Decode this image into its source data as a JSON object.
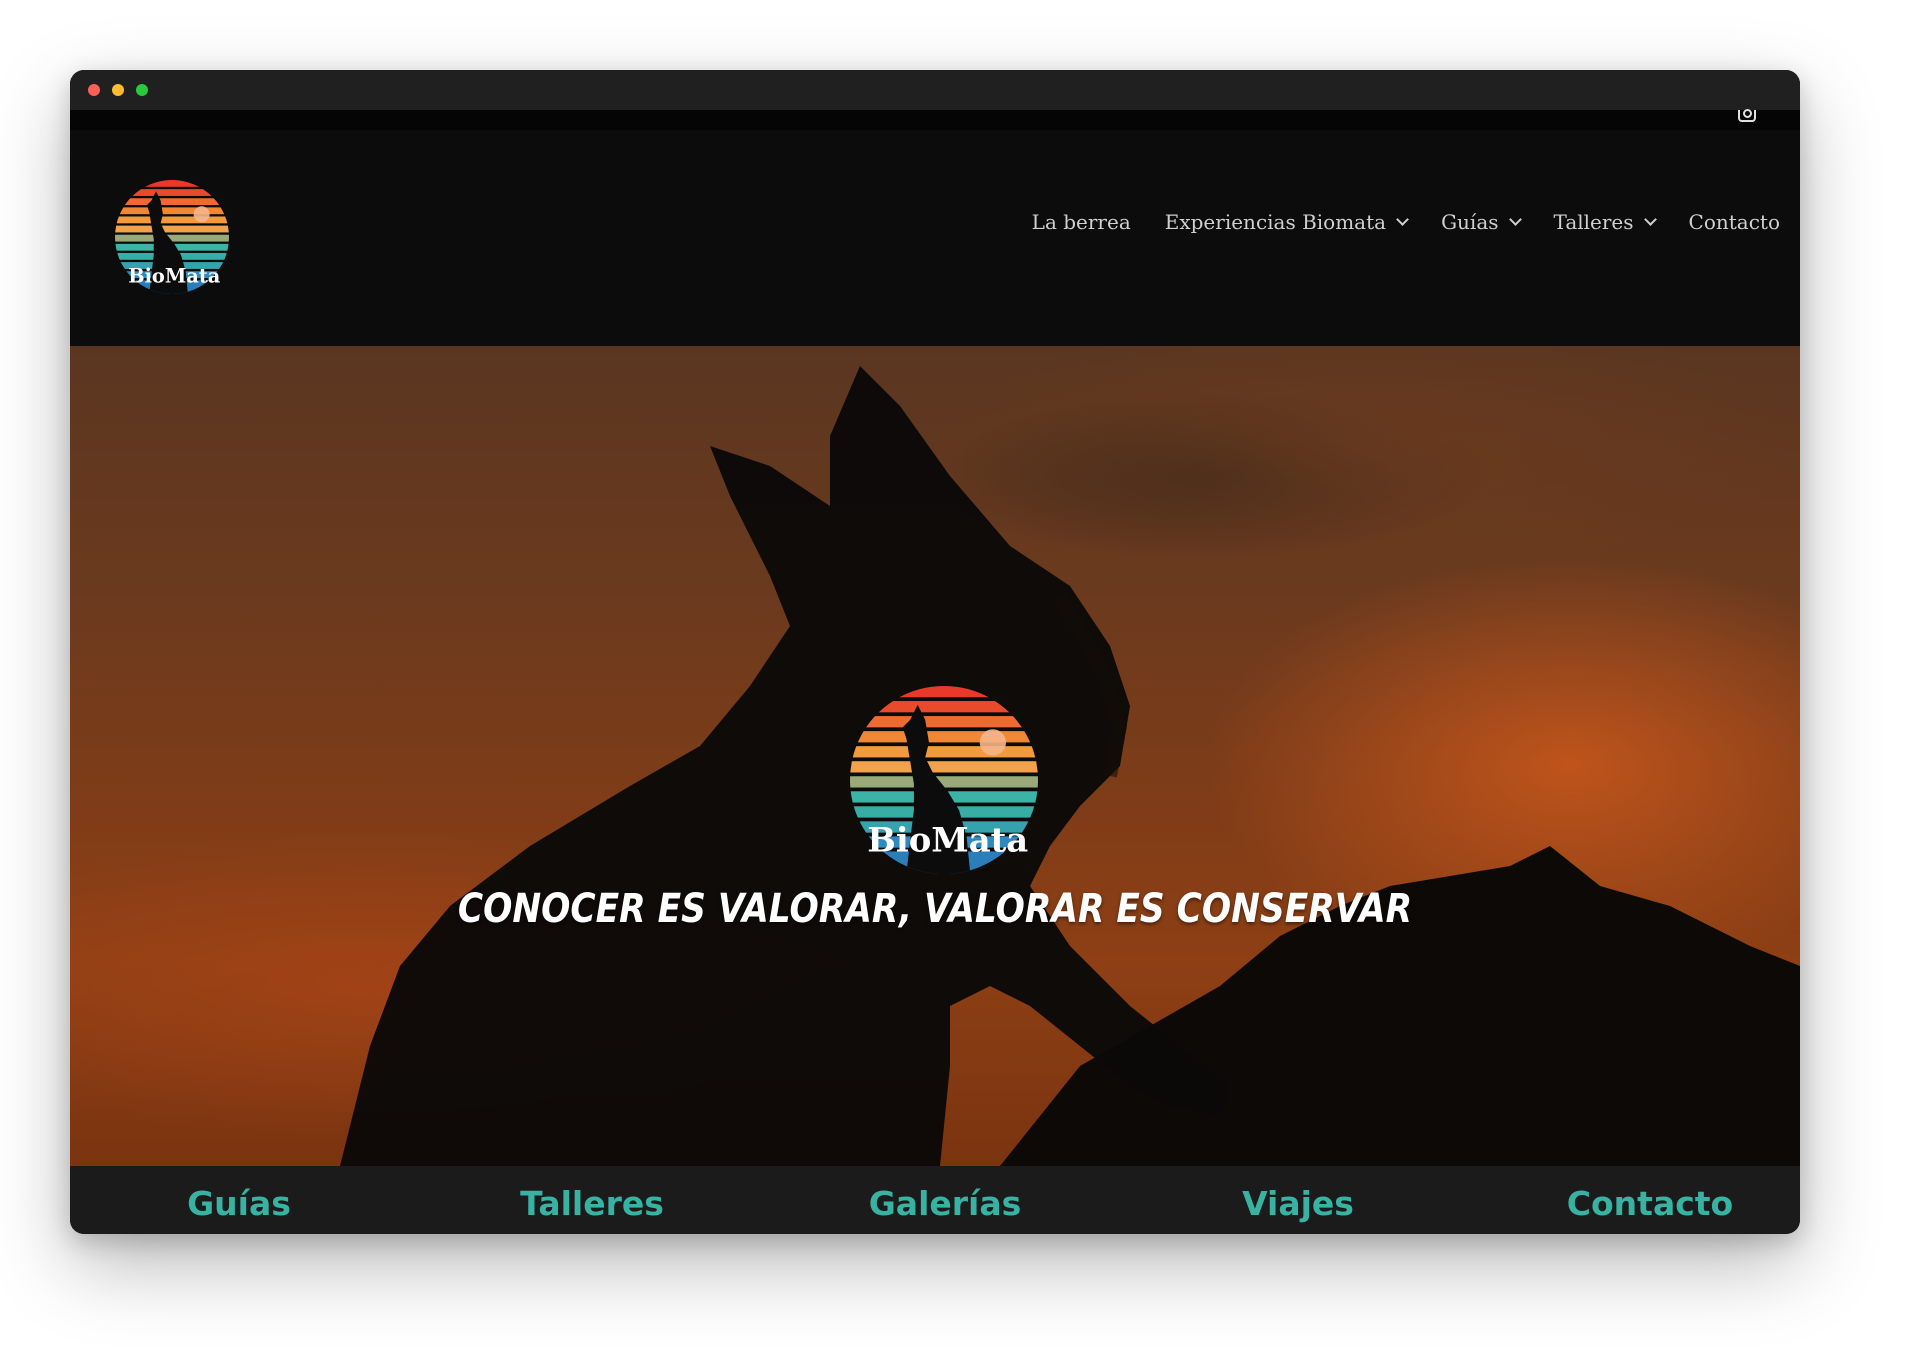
{
  "window": {
    "controls": [
      "close",
      "minimize",
      "maximize"
    ]
  },
  "topbar": {
    "social_icon": "instagram-icon"
  },
  "header": {
    "logo_text": "BioMata",
    "nav": [
      {
        "label": "La berrea",
        "has_dropdown": false
      },
      {
        "label": "Experiencias Biomata",
        "has_dropdown": true
      },
      {
        "label": "Guías",
        "has_dropdown": true
      },
      {
        "label": "Talleres",
        "has_dropdown": true
      },
      {
        "label": "Contacto",
        "has_dropdown": false
      }
    ]
  },
  "hero": {
    "logo_text": "BioMata",
    "tagline": "CONOCER ES VALORAR, VALORAR ES CONSERVAR"
  },
  "bottom_nav": [
    {
      "label": "Guías"
    },
    {
      "label": "Talleres"
    },
    {
      "label": "Galerías"
    },
    {
      "label": "Viajes"
    },
    {
      "label": "Contacto"
    }
  ],
  "colors": {
    "accent_teal": "#38b2a2",
    "header_bg": "#0c0c0c",
    "bottom_bar_bg": "#1b1b1b",
    "logo_red": "#e8392a",
    "logo_orange": "#f39a3c",
    "logo_teal": "#3bb3a7",
    "logo_blue": "#2e8bc0"
  }
}
